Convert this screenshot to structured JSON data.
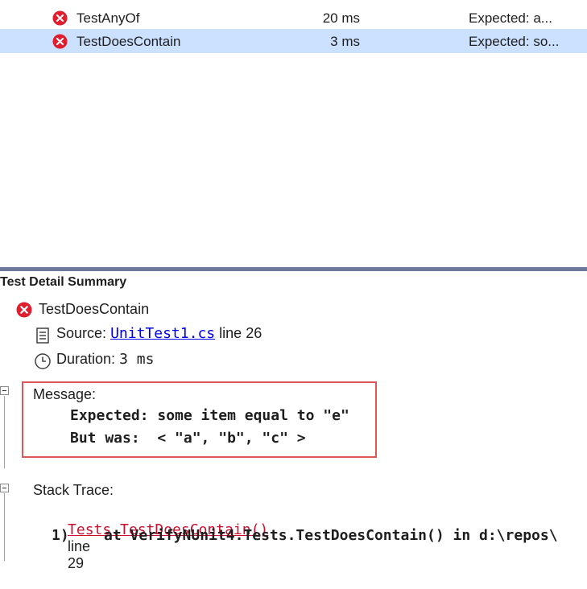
{
  "test_list": {
    "rows": [
      {
        "name": "TestAnyOf",
        "duration": "20 ms",
        "message": "Expected: a...",
        "selected": false,
        "status": "failed"
      },
      {
        "name": "TestDoesContain",
        "duration": "3 ms",
        "message": "Expected: so...",
        "selected": true,
        "status": "failed"
      }
    ]
  },
  "detail": {
    "title": "Test Detail Summary",
    "test_name": "TestDoesContain",
    "source_label": "Source",
    "source_colon": ":",
    "source_file": "UnitTest1.cs",
    "source_line_word": "line",
    "source_line_num": "26",
    "duration_label": "Duration",
    "duration_colon": ":",
    "duration_value": "3 ms",
    "message_label": "Message",
    "message_colon": ":",
    "message_lines": [
      "Expected: some item equal to \"e\"",
      "But was:  < \"a\", \"b\", \"c\" >"
    ],
    "stack_label": "Stack Trace",
    "stack_colon": ":",
    "stack_link": "Tests.TestDoesContain()",
    "stack_line_word": "line",
    "stack_line_num": "29",
    "stack_frame": "1)    at VerifyNUnit4.Tests.TestDoesContain() in d:\\repos\\"
  },
  "colors": {
    "failed": "#e01e2d",
    "selected_row": "#cce0ff",
    "splitter": "#6d7a99",
    "highlight_box": "#e05555"
  }
}
